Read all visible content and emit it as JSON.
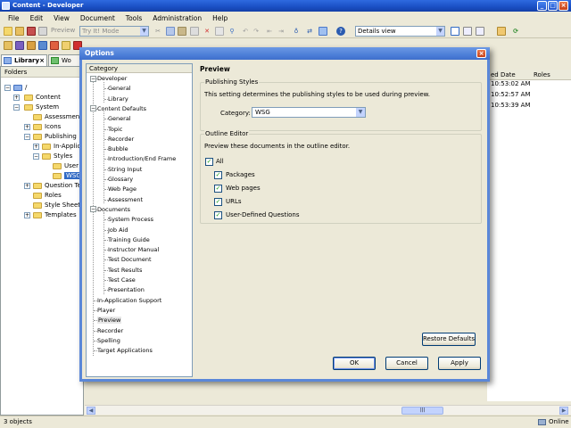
{
  "window": {
    "title": "Content - Developer",
    "controls": [
      "_",
      "□",
      "×"
    ]
  },
  "menu": [
    "File",
    "Edit",
    "View",
    "Document",
    "Tools",
    "Administration",
    "Help"
  ],
  "toolbar": {
    "preview_label": "Preview",
    "mode_value": "Try It! Mode",
    "view_value": "Details view"
  },
  "tabs": [
    {
      "label": "Library",
      "close": "×"
    },
    {
      "label": "Wo"
    }
  ],
  "library": {
    "header": "Folders",
    "tree": [
      {
        "label": "/"
      },
      {
        "label": "Content"
      },
      {
        "label": "System"
      },
      {
        "label": "Assessment T"
      },
      {
        "label": "Icons"
      },
      {
        "label": "Publishing"
      },
      {
        "label": "In-Applica"
      },
      {
        "label": "Styles"
      },
      {
        "label": "User P"
      },
      {
        "label": "WSG"
      },
      {
        "label": "Question Tem"
      },
      {
        "label": "Roles"
      },
      {
        "label": "Style Sheets"
      },
      {
        "label": "Templates"
      }
    ],
    "expanders": [
      "−",
      "+",
      "−",
      "+",
      "+",
      "−",
      "+",
      "−",
      "+",
      "+"
    ]
  },
  "grid": {
    "columns": [
      "ed Date",
      "Roles"
    ],
    "rows": [
      "10:53:02 AM",
      "10:52:57 AM",
      "10:53:39 AM"
    ]
  },
  "status": {
    "left": "3 objects",
    "right": "Online"
  },
  "dialog": {
    "title": "Options",
    "close": "×",
    "category_header": "Category",
    "categories": [
      {
        "label": "Developer",
        "level": 0,
        "expanded": true
      },
      {
        "label": "General",
        "level": 1
      },
      {
        "label": "Library",
        "level": 1
      },
      {
        "label": "Content Defaults",
        "level": 0,
        "expanded": true
      },
      {
        "label": "General",
        "level": 1
      },
      {
        "label": "Topic",
        "level": 1
      },
      {
        "label": "Recorder",
        "level": 1
      },
      {
        "label": "Bubble",
        "level": 1
      },
      {
        "label": "Introduction/End Frame",
        "level": 1
      },
      {
        "label": "String Input",
        "level": 1
      },
      {
        "label": "Glossary",
        "level": 1
      },
      {
        "label": "Web Page",
        "level": 1
      },
      {
        "label": "Assessment",
        "level": 1
      },
      {
        "label": "Documents",
        "level": 0,
        "expanded": true
      },
      {
        "label": "System Process",
        "level": 1
      },
      {
        "label": "Job Aid",
        "level": 1
      },
      {
        "label": "Training Guide",
        "level": 1
      },
      {
        "label": "Instructor Manual",
        "level": 1
      },
      {
        "label": "Test Document",
        "level": 1
      },
      {
        "label": "Test Results",
        "level": 1
      },
      {
        "label": "Test Case",
        "level": 1
      },
      {
        "label": "Presentation",
        "level": 1
      },
      {
        "label": "In-Application Support",
        "level": 0
      },
      {
        "label": "Player",
        "level": 0
      },
      {
        "label": "Preview",
        "level": 0,
        "selected": true
      },
      {
        "label": "Recorder",
        "level": 0
      },
      {
        "label": "Spelling",
        "level": 0
      },
      {
        "label": "Target Applications",
        "level": 0
      }
    ],
    "expand_glyph": "−",
    "pane_title": "Preview",
    "publishing_styles": {
      "group_label": "Publishing Styles",
      "description": "This setting determines the publishing styles to be used during preview.",
      "category_label": "Category:",
      "category_value": "WSG"
    },
    "outline_editor": {
      "group_label": "Outline Editor",
      "description": "Preview these documents in the outline editor.",
      "all_label": "All",
      "all_checked": true,
      "items": [
        {
          "label": "Packages",
          "checked": true
        },
        {
          "label": "Web pages",
          "checked": true
        },
        {
          "label": "URLs",
          "checked": true
        },
        {
          "label": "User-Defined Questions",
          "checked": true
        }
      ]
    },
    "check_glyph": "✓",
    "buttons": {
      "restore": "Restore Defaults",
      "ok": "OK",
      "cancel": "Cancel",
      "apply": "Apply"
    }
  }
}
